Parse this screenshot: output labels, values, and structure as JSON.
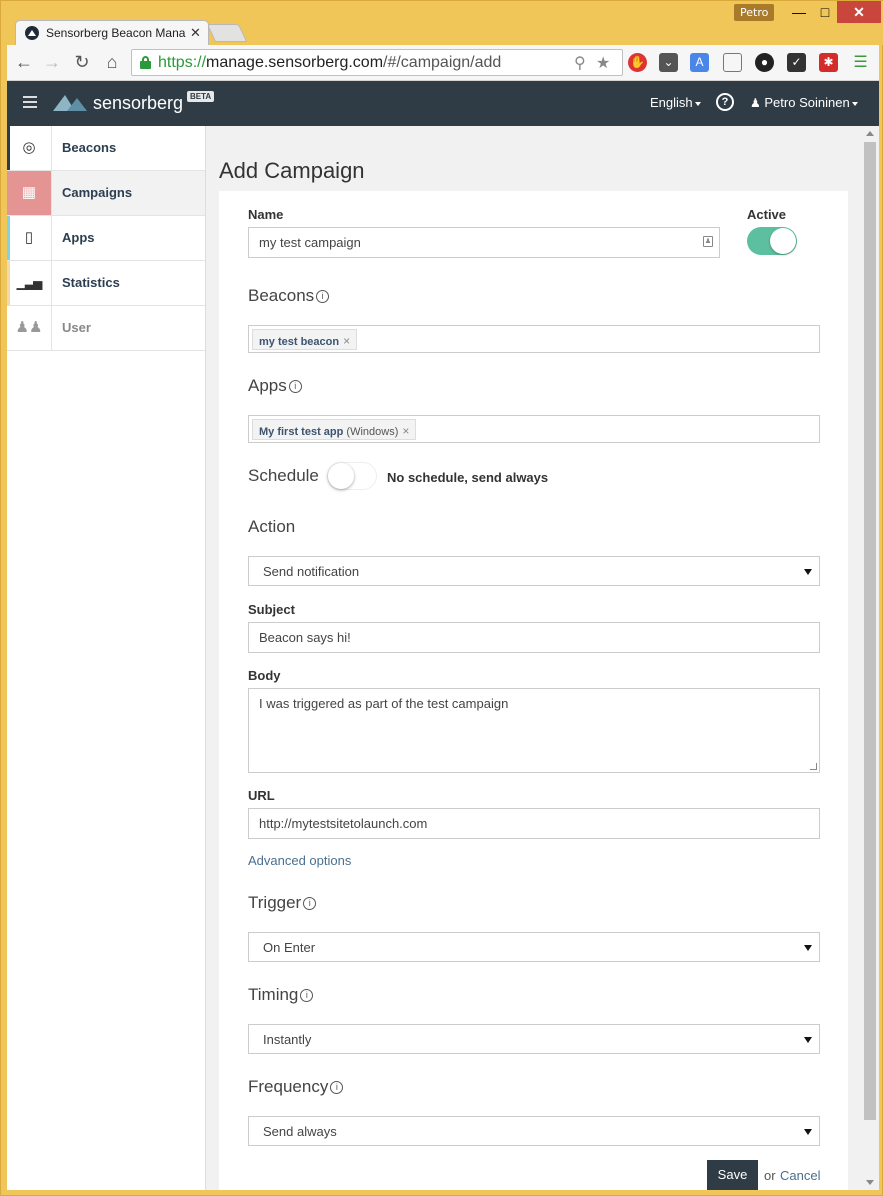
{
  "browser": {
    "os_user": "Petro",
    "tab_title": "Sensorberg Beacon Mana",
    "url_scheme": "https://",
    "url_host": "manage.sensorberg.com",
    "url_path": "/#/campaign/add"
  },
  "navbar": {
    "brand": "sensorberg",
    "beta": "BETA",
    "language": "English",
    "user": "Petro Soininen"
  },
  "sidebar": {
    "items": [
      {
        "label": "Beacons",
        "icon": "target-icon"
      },
      {
        "label": "Campaigns",
        "icon": "calendar-icon"
      },
      {
        "label": "Apps",
        "icon": "phone-icon"
      },
      {
        "label": "Statistics",
        "icon": "bar-chart-icon"
      },
      {
        "label": "User",
        "icon": "users-icon"
      }
    ]
  },
  "page": {
    "title": "Add Campaign"
  },
  "form": {
    "name_label": "Name",
    "name_value": "my test campaign",
    "active_label": "Active",
    "beacons_label": "Beacons",
    "beacon_tag": "my test beacon",
    "apps_label": "Apps",
    "app_tag_name": "My first test app",
    "app_tag_platform": "(Windows)",
    "schedule_label": "Schedule",
    "schedule_status": "No schedule, send always",
    "action_label": "Action",
    "action_value": "Send notification",
    "subject_label": "Subject",
    "subject_value": "Beacon says hi!",
    "body_label": "Body",
    "body_value": "I was triggered as part of the test campaign",
    "url_label": "URL",
    "url_value": "http://mytestsitetolaunch.com",
    "advanced_link": "Advanced options",
    "trigger_label": "Trigger",
    "trigger_value": "On Enter",
    "timing_label": "Timing",
    "timing_value": "Instantly",
    "frequency_label": "Frequency",
    "frequency_value": "Send always",
    "save_label": "Save",
    "or_text": "or",
    "cancel_label": "Cancel"
  },
  "colors": {
    "navbar": "#2f3b45",
    "toggle_on": "#5cbf9f",
    "campaigns_accent": "#e59494"
  }
}
